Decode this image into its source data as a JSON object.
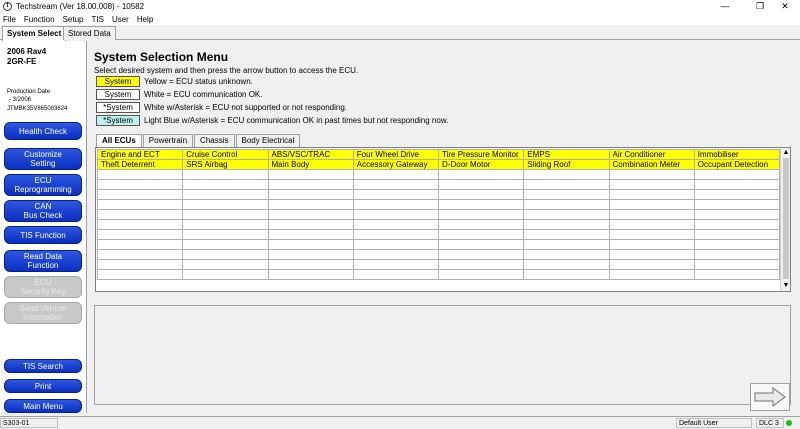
{
  "window": {
    "title": "Techstream (Ver 18.00.008) - 10582",
    "minimize": "—",
    "restore": "❐",
    "close": "✕"
  },
  "menu": [
    "File",
    "Function",
    "Setup",
    "TIS",
    "User",
    "Help"
  ],
  "top_tabs": [
    {
      "label": "System Select",
      "active": true
    },
    {
      "label": "Stored Data",
      "active": false
    }
  ],
  "vehicle": {
    "model": "2006 Rav4",
    "engine": "2GR-FE",
    "production_label": "Production Date",
    "production_date": "- 3/2006",
    "vin": "JTMBK35V865003624"
  },
  "nav_buttons": [
    {
      "label": "Health Check",
      "enabled": true
    },
    {
      "label": "Customize\nSetting",
      "enabled": true
    },
    {
      "label": "ECU\nReprogramming",
      "enabled": true
    },
    {
      "label": "CAN\nBus Check",
      "enabled": true
    },
    {
      "label": "TIS Function",
      "enabled": true
    },
    {
      "label": "Read Data\nFunction",
      "enabled": true
    },
    {
      "label": "ECU\nSecurity Key",
      "enabled": false
    },
    {
      "label": "Send Vehicle\nInformation",
      "enabled": false
    },
    {
      "label": "TIS Search",
      "enabled": true
    },
    {
      "label": "Print",
      "enabled": true
    },
    {
      "label": "Main Menu",
      "enabled": true
    }
  ],
  "page": {
    "title": "System Selection Menu",
    "instruction": "Select desired system and then press the arrow button to access the ECU."
  },
  "legend": [
    {
      "swatch": "System",
      "color": "#ffff00",
      "text": "Yellow = ECU status unknown."
    },
    {
      "swatch": "System",
      "color": "#ffffff",
      "text": "White = ECU communication OK."
    },
    {
      "swatch": "*System",
      "color": "#ffffff",
      "text": "White w/Asterisk = ECU not supported or not responding."
    },
    {
      "swatch": "*System",
      "color": "#bff0f0",
      "text": "Light Blue w/Asterisk = ECU communication OK in past times but not responding now."
    }
  ],
  "ecu_tabs": [
    {
      "label": "All ECUs",
      "active": true
    },
    {
      "label": "Powertrain",
      "active": false
    },
    {
      "label": "Chassis",
      "active": false
    },
    {
      "label": "Body Electrical",
      "active": false
    }
  ],
  "ecu_rows": [
    [
      "Engine and ECT",
      "Cruise Control",
      "ABS/VSC/TRAC",
      "Four Wheel Drive",
      "Tire Pressure Monitor",
      "EMPS",
      "Air Conditioner",
      "Immobiliser"
    ],
    [
      "Theft Deterrent",
      "SRS Airbag",
      "Main Body",
      "Accessory Gateway",
      "D-Door Motor",
      "Sliding Roof",
      "Combination Meter",
      "Occupant Detection"
    ]
  ],
  "empty_rows": 11,
  "status": {
    "left": "S303-01",
    "user": "Default User",
    "dlc": "DLC 3"
  },
  "colors": {
    "ecu_unknown": "#ffff00",
    "nav_button": "#1a45d8",
    "dlc_connected": "#19c019"
  }
}
